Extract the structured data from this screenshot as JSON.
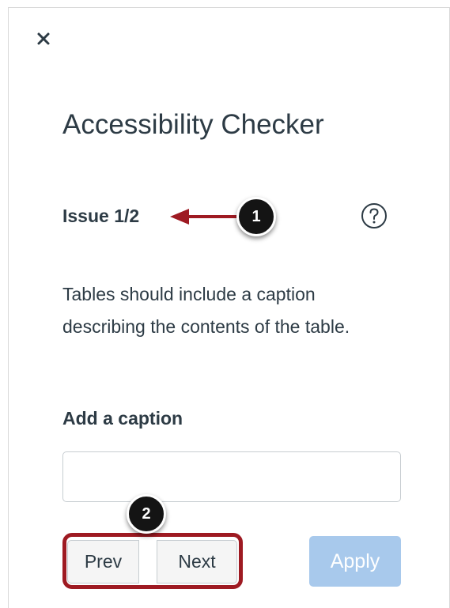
{
  "panel": {
    "title": "Accessibility Checker",
    "issue_label": "Issue 1/2",
    "description": "Tables should include a caption describing the contents of the table.",
    "field_label": "Add a caption",
    "caption_value": "",
    "caption_placeholder": ""
  },
  "buttons": {
    "close": "×",
    "prev": "Prev",
    "next": "Next",
    "apply": "Apply",
    "help": "?"
  },
  "callouts": {
    "first": "1",
    "second": "2"
  },
  "icons": {
    "close": "close-icon",
    "help": "question-circle-icon",
    "arrow": "left-arrow-icon"
  },
  "colors": {
    "text": "#2d3b45",
    "apply_disabled": "#a8c9ec",
    "callout_bg": "#141414",
    "highlight": "#9e1a22",
    "arrow": "#9e1a22"
  }
}
